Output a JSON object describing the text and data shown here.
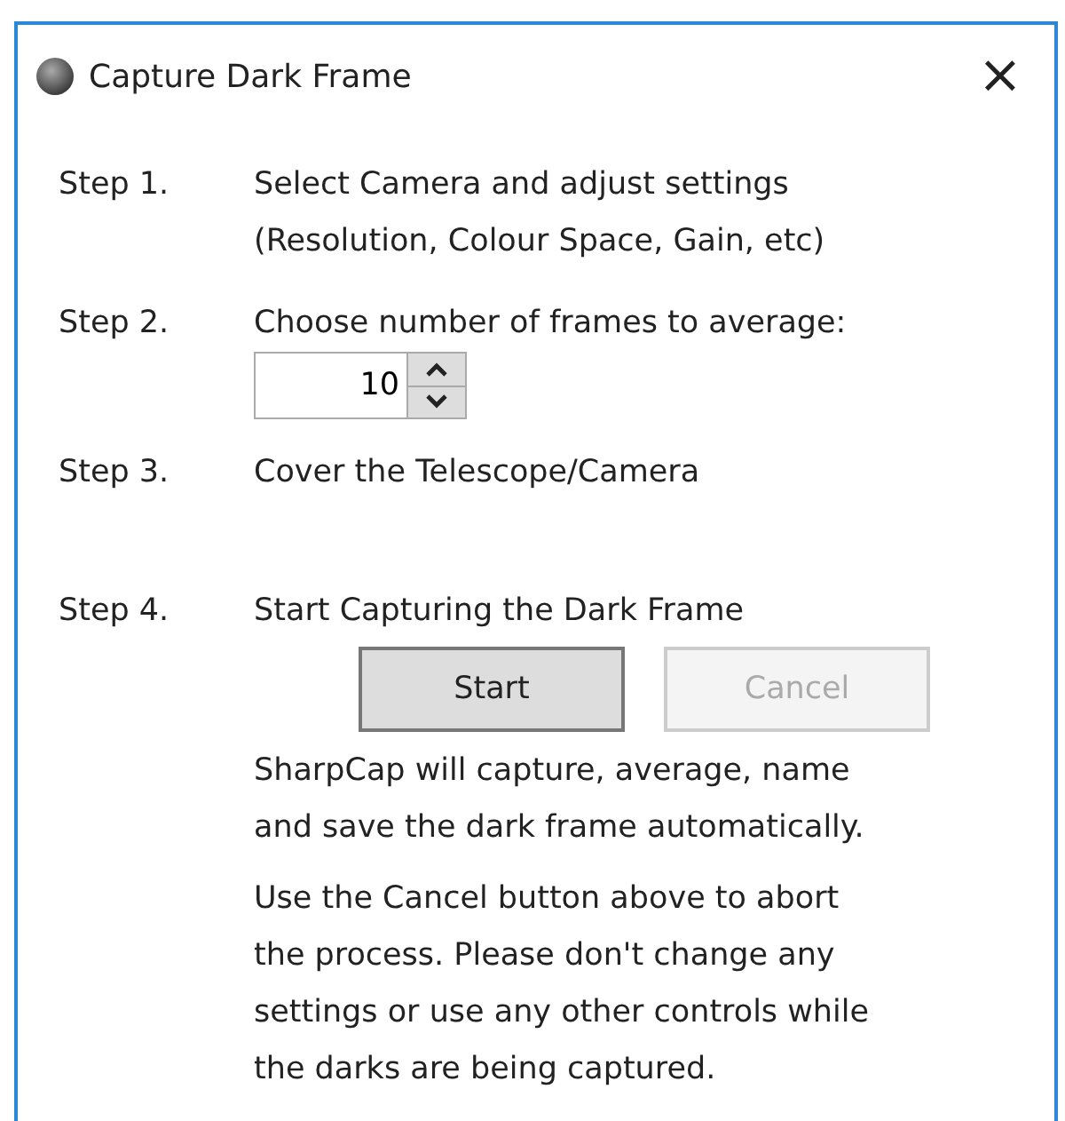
{
  "window": {
    "title": "Capture Dark Frame",
    "close": "×"
  },
  "steps": [
    {
      "label": "Step 1.",
      "text": "Select Camera and adjust settings\n(Resolution, Colour Space, Gain, etc)"
    },
    {
      "label": "Step 2.",
      "text": "Choose number of frames to average:",
      "spinner": {
        "value": "10"
      }
    },
    {
      "label": "Step 3.",
      "text": "Cover the Telescope/Camera"
    },
    {
      "label": "Step 4.",
      "text": "Start Capturing the Dark Frame",
      "buttons": [
        {
          "label": "Start",
          "disabled": false
        },
        {
          "label": "Cancel",
          "disabled": true
        }
      ],
      "notes": [
        "SharpCap will capture, average, name\nand save the dark frame automatically.",
        "Use the Cancel button above to abort\nthe process. Please don't change any\nsettings or use any other controls while\nthe darks are being captured."
      ]
    }
  ]
}
